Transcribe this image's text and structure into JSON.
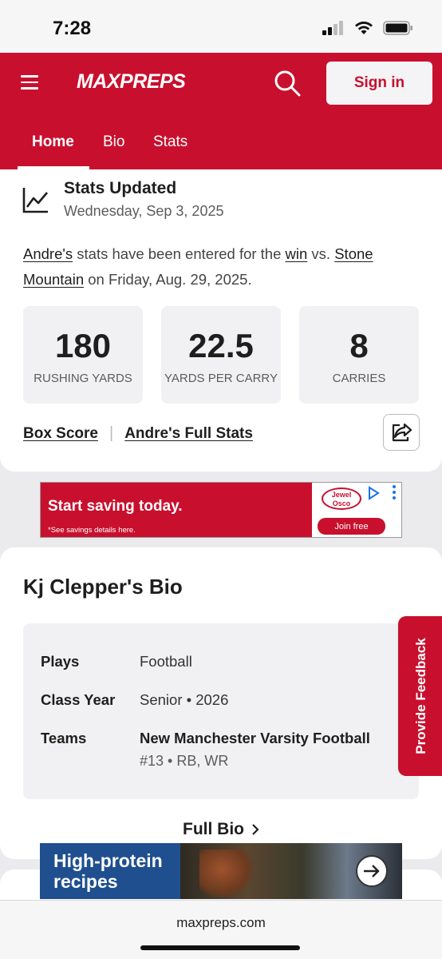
{
  "status_bar": {
    "time": "7:28"
  },
  "header": {
    "logo": "MAXPREPS",
    "signin_label": "Sign in",
    "accent": "#c8102e"
  },
  "tabs": [
    {
      "label": "Home",
      "active": true
    },
    {
      "label": "Bio",
      "active": false
    },
    {
      "label": "Stats",
      "active": false
    }
  ],
  "stats_update": {
    "title": "Stats Updated",
    "date": "Wednesday, Sep 3, 2025",
    "text": {
      "player": "Andre's",
      "t1": " stats have been entered for the ",
      "result": "win",
      "t2": " vs. ",
      "opponent": "Stone Mountain",
      "t3": " on Friday, Aug. 29, 2025."
    },
    "stats": [
      {
        "value": "180",
        "label": "RUSHING YARDS"
      },
      {
        "value": "22.5",
        "label": "YARDS PER CARRY"
      },
      {
        "value": "8",
        "label": "CARRIES"
      }
    ],
    "links": {
      "box_score": "Box Score",
      "separator": "|",
      "full_stats": "Andre's Full Stats"
    }
  },
  "ad1": {
    "title": "Start saving today.",
    "note": "*See savings details here.",
    "brand": "Jewel Osco",
    "cta": "Join free"
  },
  "bio": {
    "title": "Kj Clepper's Bio",
    "rows": {
      "plays_label": "Plays",
      "plays_value": "Football",
      "class_label": "Class Year",
      "class_value": "Senior • 2026",
      "teams_label": "Teams",
      "teams_value": "New Manchester Varsity Football",
      "teams_sub": "#13 • RB, WR"
    },
    "full_bio": "Full Bio"
  },
  "feedback": {
    "label": "Provide Feedback"
  },
  "ad2": {
    "line1": "High-protein",
    "line2": "recipes"
  },
  "url_bar": {
    "url": "maxpreps.com"
  }
}
